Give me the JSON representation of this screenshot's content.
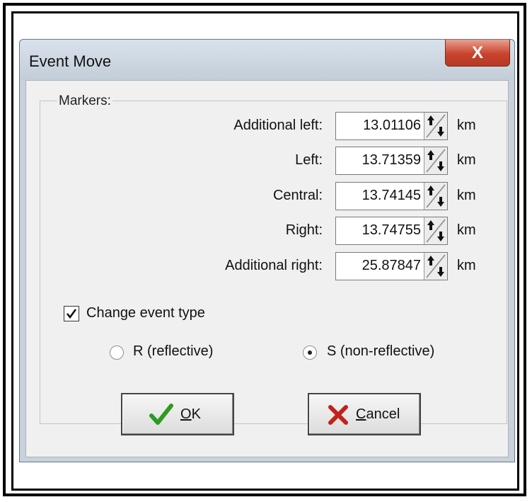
{
  "window": {
    "title": "Event Move",
    "close_glyph": "X"
  },
  "markers": {
    "label": "Markers:",
    "rows": [
      {
        "label": "Additional left:",
        "value": "13.01106",
        "unit": "km"
      },
      {
        "label": "Left:",
        "value": "13.71359",
        "unit": "km"
      },
      {
        "label": "Central:",
        "value": "13.74145",
        "unit": "km"
      },
      {
        "label": "Right:",
        "value": "13.74755",
        "unit": "km"
      },
      {
        "label": "Additional right:",
        "value": "25.87847",
        "unit": "km"
      }
    ]
  },
  "change_event_type": {
    "label": "Change event type",
    "checked": true
  },
  "event_type": {
    "options": [
      {
        "label": "R (reflective)",
        "selected": false
      },
      {
        "label": "S (non-reflective)",
        "selected": true
      }
    ]
  },
  "buttons": {
    "ok": {
      "mnemonic": "O",
      "rest": "K"
    },
    "cancel": {
      "mnemonic": "C",
      "rest": "ancel"
    }
  },
  "icons": {
    "ok": "checkmark-icon",
    "cancel": "red-x-icon",
    "spin": "spin-arrows-icon"
  },
  "colors": {
    "ok_icon": "#2e9a1f",
    "cancel_icon": "#c0231a",
    "close_button": "#c8432c"
  }
}
